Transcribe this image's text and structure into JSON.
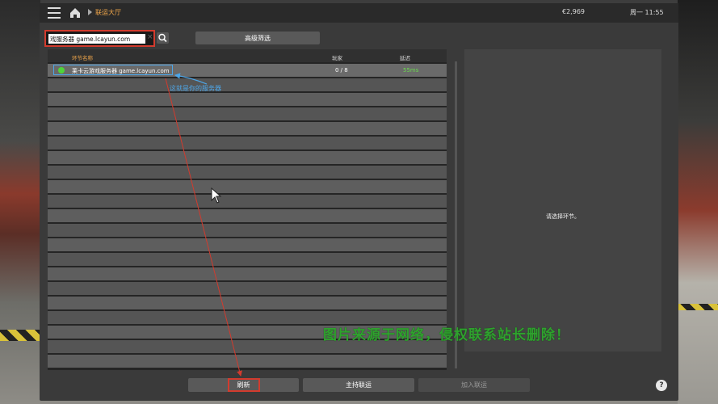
{
  "topbar": {
    "breadcrumb": "联运大厅",
    "money": "€2,969",
    "clock": "周一 11:55"
  },
  "search": {
    "value": "戏服务器 game.lcayun.com",
    "clear_glyph": "×"
  },
  "advanced_filter_label": "高级筛选",
  "list": {
    "columns": {
      "name": "环节名称",
      "players": "玩家",
      "ping": "延迟"
    },
    "server": {
      "name": "莱卡云游戏服务器 game.lcayun.com",
      "players": "0 / 8",
      "ping": "55ms",
      "status_color": "#4fd43a"
    }
  },
  "details": {
    "placeholder": "请选择环节。"
  },
  "buttons": {
    "refresh": "刷新",
    "host": "主持联运",
    "join": "加入联运",
    "help": "?"
  },
  "annotation": "这就是你的服务器",
  "watermark": "图片来源于网络，侵权联系站长删除！",
  "colors": {
    "accent": "#f0a64a",
    "highlight_box": "#4da6e8",
    "annotation_red": "#d23b2e"
  }
}
